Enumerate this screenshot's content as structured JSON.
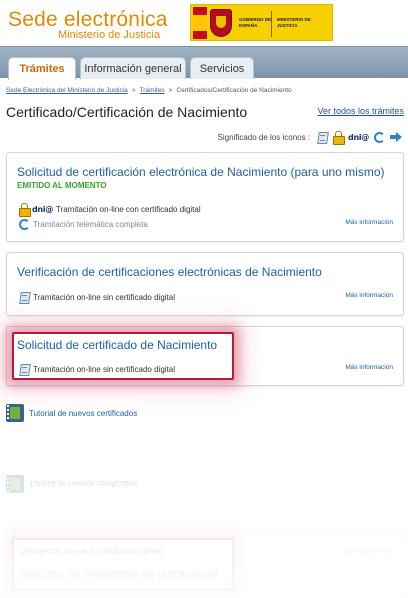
{
  "header": {
    "brand_title": "Sede electrónica",
    "brand_subtitle": "Ministerio de Justicia",
    "gov_text_left": "GOBIERNO DE ESPAÑA",
    "gov_text_right": "MINISTERIO DE JUSTICIA"
  },
  "tabs": [
    {
      "label": "Trámites",
      "active": true
    },
    {
      "label": "Información general",
      "active": false
    },
    {
      "label": "Servicios",
      "active": false
    }
  ],
  "breadcrumb": {
    "items": [
      "Sede Electrónica del Ministerio de Justicia",
      "Trámites",
      "Certificados/Certificación de Nacimiento"
    ],
    "separator": ">"
  },
  "page": {
    "title": "Certificado/Certificación de Nacimiento",
    "view_all_link": "Ver todos los trámites",
    "legend_label": "Significado de los iconos :",
    "legend_icons": [
      "card-icon",
      "lock-icon",
      "dni-icon",
      "refresh-icon",
      "arrow-icon"
    ]
  },
  "procedures": [
    {
      "title": "Solicitud de certificación electrónica de Nacimiento (para uno mismo)",
      "badge": "EMITIDO AL MOMENTO",
      "line1": "Tramitación on-line con certificado digital",
      "line2": "Tramitación telemática completa",
      "more_info": "Más información"
    },
    {
      "title": "Verificación de certificaciones electrónicas de Nacimiento",
      "line1": "Tramitación on-line sin certificado digital",
      "more_info": "Más información"
    },
    {
      "title": "Solicitud de certificado de Nacimiento",
      "line1": "Tramitación on-line sin certificado digital",
      "more_info": "Más información"
    }
  ],
  "tutorial_link": "Tutorial de nuevos certificados",
  "dni_text": "dni@",
  "colors": {
    "brand_orange": "#e28a00",
    "link_blue": "#1d5fa8",
    "badge_green": "#3aa12f",
    "highlight_red": "#b01c3a"
  }
}
